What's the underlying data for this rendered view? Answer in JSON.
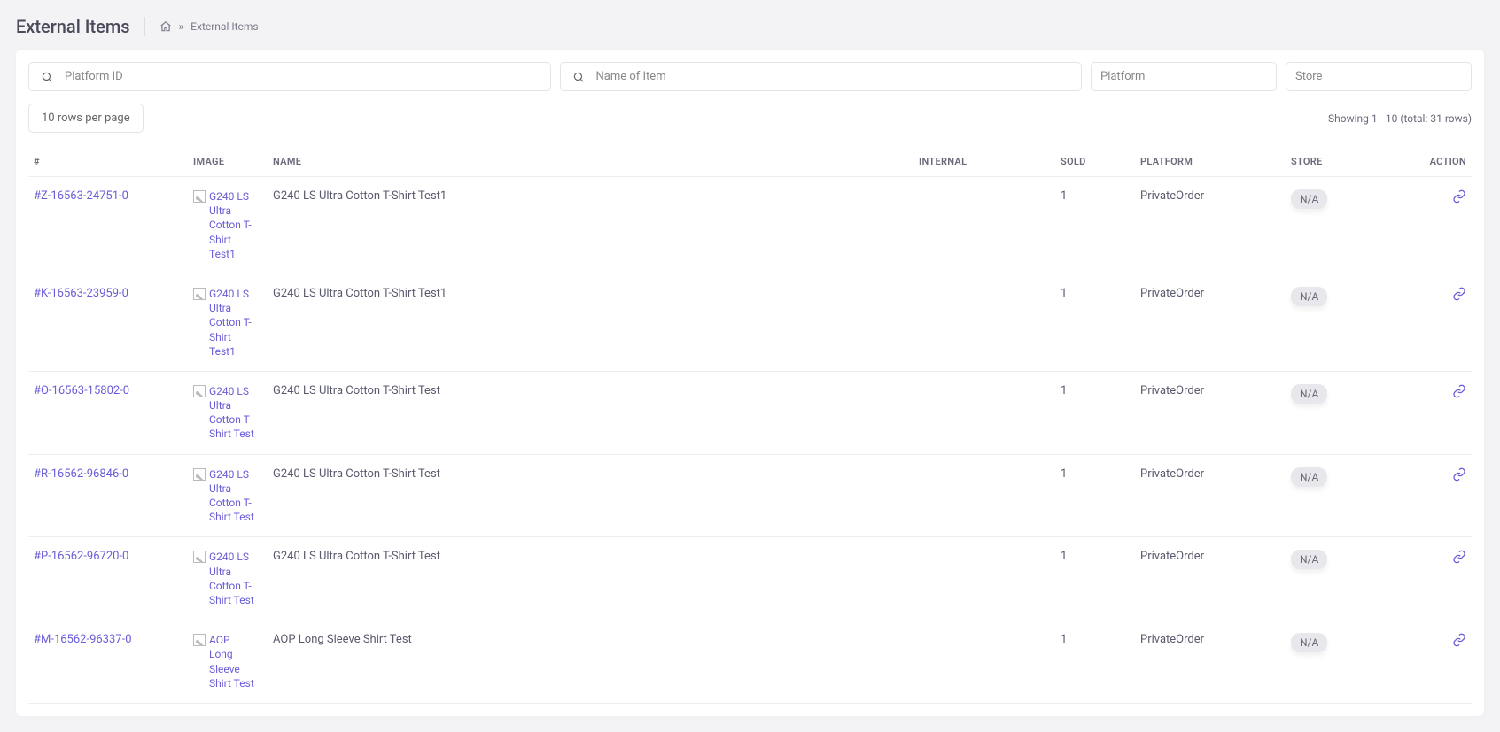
{
  "header": {
    "title": "External Items",
    "breadcrumb_sep": "»",
    "breadcrumb_current": "External Items"
  },
  "filters": {
    "platform_id_placeholder": "Platform ID",
    "name_placeholder": "Name of Item",
    "platform_placeholder": "Platform",
    "store_placeholder": "Store"
  },
  "toolbar": {
    "rows_select_label": "10 rows per page",
    "showing": "Showing 1 - 10 (total: 31 rows)"
  },
  "table": {
    "headers": {
      "id": "#",
      "image": "IMAGE",
      "name": "NAME",
      "internal": "INTERNAL",
      "sold": "SOLD",
      "platform": "PLATFORM",
      "store": "STORE",
      "action": "ACTION"
    },
    "rows": [
      {
        "id": "#Z-16563-24751-0",
        "img_alt": "G240 LS Ultra Cotton T-Shirt Test1",
        "name": "G240 LS Ultra Cotton T-Shirt Test1",
        "internal": "",
        "sold": "1",
        "platform": "PrivateOrder",
        "store": "N/A"
      },
      {
        "id": "#K-16563-23959-0",
        "img_alt": "G240 LS Ultra Cotton T-Shirt Test1",
        "name": "G240 LS Ultra Cotton T-Shirt Test1",
        "internal": "",
        "sold": "1",
        "platform": "PrivateOrder",
        "store": "N/A"
      },
      {
        "id": "#O-16563-15802-0",
        "img_alt": "G240 LS Ultra Cotton T-Shirt Test",
        "name": "G240 LS Ultra Cotton T-Shirt Test",
        "internal": "",
        "sold": "1",
        "platform": "PrivateOrder",
        "store": "N/A"
      },
      {
        "id": "#R-16562-96846-0",
        "img_alt": "G240 LS Ultra Cotton T-Shirt Test",
        "name": "G240 LS Ultra Cotton T-Shirt Test",
        "internal": "",
        "sold": "1",
        "platform": "PrivateOrder",
        "store": "N/A"
      },
      {
        "id": "#P-16562-96720-0",
        "img_alt": "G240 LS Ultra Cotton T-Shirt Test",
        "name": "G240 LS Ultra Cotton T-Shirt Test",
        "internal": "",
        "sold": "1",
        "platform": "PrivateOrder",
        "store": "N/A"
      },
      {
        "id": "#M-16562-96337-0",
        "img_alt": "AOP Long Sleeve Shirt Test",
        "name": "AOP Long Sleeve Shirt Test",
        "internal": "",
        "sold": "1",
        "platform": "PrivateOrder",
        "store": "N/A"
      }
    ]
  }
}
